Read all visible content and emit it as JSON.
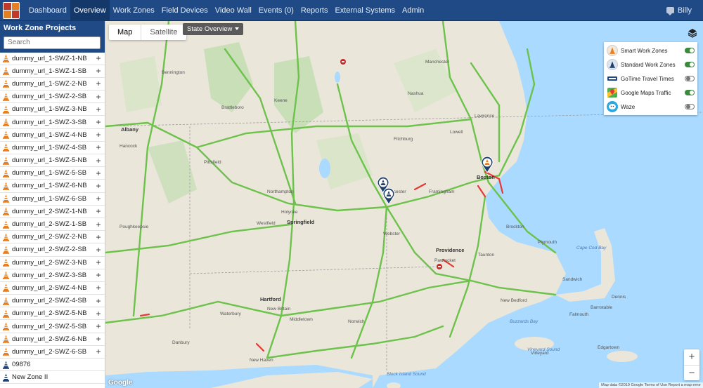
{
  "nav": {
    "items": [
      "Dashboard",
      "Overview",
      "Work Zones",
      "Field Devices",
      "Video Wall",
      "Events (0)",
      "Reports",
      "External Systems",
      "Admin"
    ],
    "active_index": 1,
    "user": "Billy"
  },
  "sidebar": {
    "title": "Work Zone Projects",
    "search_placeholder": "Search",
    "projects": [
      {
        "label": "dummy_url_1-SWZ-1-NB",
        "icon": "smart-cone"
      },
      {
        "label": "dummy_url_1-SWZ-1-SB",
        "icon": "smart-cone"
      },
      {
        "label": "dummy_url_1-SWZ-2-NB",
        "icon": "smart-cone"
      },
      {
        "label": "dummy_url_1-SWZ-2-SB",
        "icon": "smart-cone"
      },
      {
        "label": "dummy_url_1-SWZ-3-NB",
        "icon": "smart-cone"
      },
      {
        "label": "dummy_url_1-SWZ-3-SB",
        "icon": "smart-cone"
      },
      {
        "label": "dummy_url_1-SWZ-4-NB",
        "icon": "smart-cone"
      },
      {
        "label": "dummy_url_1-SWZ-4-SB",
        "icon": "smart-cone"
      },
      {
        "label": "dummy_url_1-SWZ-5-NB",
        "icon": "smart-cone"
      },
      {
        "label": "dummy_url_1-SWZ-5-SB",
        "icon": "smart-cone"
      },
      {
        "label": "dummy_url_1-SWZ-6-NB",
        "icon": "smart-cone"
      },
      {
        "label": "dummy_url_1-SWZ-6-SB",
        "icon": "smart-cone"
      },
      {
        "label": "dummy_url_2-SWZ-1-NB",
        "icon": "smart-cone"
      },
      {
        "label": "dummy_url_2-SWZ-1-SB",
        "icon": "smart-cone"
      },
      {
        "label": "dummy_url_2-SWZ-2-NB",
        "icon": "smart-cone"
      },
      {
        "label": "dummy_url_2-SWZ-2-SB",
        "icon": "smart-cone"
      },
      {
        "label": "dummy_url_2-SWZ-3-NB",
        "icon": "smart-cone"
      },
      {
        "label": "dummy_url_2-SWZ-3-SB",
        "icon": "smart-cone"
      },
      {
        "label": "dummy_url_2-SWZ-4-NB",
        "icon": "smart-cone"
      },
      {
        "label": "dummy_url_2-SWZ-4-SB",
        "icon": "smart-cone"
      },
      {
        "label": "dummy_url_2-SWZ-5-NB",
        "icon": "smart-cone"
      },
      {
        "label": "dummy_url_2-SWZ-5-SB",
        "icon": "smart-cone"
      },
      {
        "label": "dummy_url_2-SWZ-6-NB",
        "icon": "smart-cone"
      },
      {
        "label": "dummy_url_2-SWZ-6-SB",
        "icon": "smart-cone"
      },
      {
        "label": "09876",
        "icon": "standard-cone"
      },
      {
        "label": "New Zone II",
        "icon": "standard-cone"
      }
    ]
  },
  "map": {
    "tabs": [
      "Map",
      "Satellite"
    ],
    "active_tab": 0,
    "state_dropdown": "State Overview",
    "legend": [
      {
        "label": "Smart Work Zones",
        "on": true,
        "icon": "smart-cone-icon",
        "color": "#f5e8d8"
      },
      {
        "label": "Standard Work Zones",
        "on": true,
        "icon": "standard-cone-icon",
        "color": "#dde4f0"
      },
      {
        "label": "GoTime Travel Times",
        "on": false,
        "icon": "gotime-icon",
        "color": "#ffffff"
      },
      {
        "label": "Google Maps Traffic",
        "on": true,
        "icon": "google-maps-icon",
        "color": "#ffffff"
      },
      {
        "label": "Waze",
        "on": false,
        "icon": "waze-icon",
        "color": "#2aa8e0"
      }
    ],
    "zoom_in": "+",
    "zoom_out": "−",
    "attribution": "Map data ©2019 Google   Terms of Use   Report a map error",
    "google_logo": "Google",
    "places": [
      {
        "name": "Albany",
        "big": true
      },
      {
        "name": "Springfield",
        "big": true
      },
      {
        "name": "Hartford",
        "big": true
      },
      {
        "name": "Boston",
        "big": true
      },
      {
        "name": "Worcester",
        "big": false
      },
      {
        "name": "Providence",
        "big": true
      },
      {
        "name": "New Haven",
        "big": false
      },
      {
        "name": "Waterbury",
        "big": false
      },
      {
        "name": "Danbury",
        "big": false
      },
      {
        "name": "Pittsfield",
        "big": false
      },
      {
        "name": "Fitchburg",
        "big": false
      },
      {
        "name": "Lawrence",
        "big": false
      },
      {
        "name": "Lowell",
        "big": false
      },
      {
        "name": "Brockton",
        "big": false
      },
      {
        "name": "Taunton",
        "big": false
      },
      {
        "name": "New Bedford",
        "big": false
      },
      {
        "name": "Plymouth",
        "big": false
      },
      {
        "name": "Framingham",
        "big": false
      },
      {
        "name": "Poughkeepsie",
        "big": false
      },
      {
        "name": "Middletown",
        "big": false
      },
      {
        "name": "New Britain",
        "big": false
      },
      {
        "name": "Holyoke",
        "big": false
      },
      {
        "name": "Northampton",
        "big": false
      },
      {
        "name": "Webster",
        "big": false
      },
      {
        "name": "Bennington",
        "big": false
      },
      {
        "name": "Brattleboro",
        "big": false
      },
      {
        "name": "Keene",
        "big": false
      },
      {
        "name": "Nashua",
        "big": false
      },
      {
        "name": "Manchester",
        "big": false
      },
      {
        "name": "Barnstable",
        "big": false
      },
      {
        "name": "Falmouth",
        "big": false
      },
      {
        "name": "Hancock",
        "big": false
      },
      {
        "name": "Westfield",
        "big": false
      },
      {
        "name": "Pawtucket",
        "big": false
      },
      {
        "name": "Norwich",
        "big": false
      },
      {
        "name": "Cape Cod Bay",
        "big": false,
        "water": true
      },
      {
        "name": "Buzzards Bay",
        "big": false,
        "water": true
      },
      {
        "name": "Vineyard Sound",
        "big": false,
        "water": true
      },
      {
        "name": "Block Island Sound",
        "big": false,
        "water": true
      },
      {
        "name": "Edgartown",
        "big": false
      },
      {
        "name": "Vineyard",
        "big": false
      },
      {
        "name": "Sandwich",
        "big": false
      },
      {
        "name": "Dennis",
        "big": false
      }
    ]
  },
  "colors": {
    "nav": "#1f4a86",
    "highway": "#6cc24a",
    "congestion": "#e53935",
    "water": "#aadaff",
    "land": "#eae6da",
    "park": "#c8dfb8"
  }
}
